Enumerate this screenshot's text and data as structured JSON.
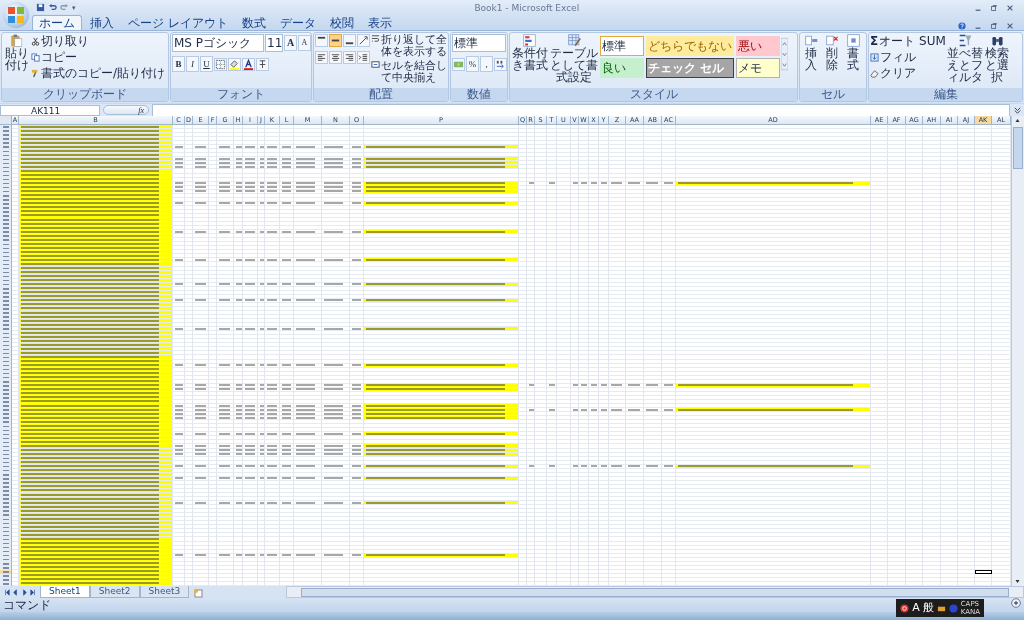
{
  "window": {
    "title": "Book1 - Microsoft Excel"
  },
  "quick_access": {
    "customize": "▾"
  },
  "tabs": [
    {
      "label": "ホーム",
      "selected": true
    },
    {
      "label": "挿入",
      "selected": false
    },
    {
      "label": "ページ レイアウト",
      "selected": false
    },
    {
      "label": "数式",
      "selected": false
    },
    {
      "label": "データ",
      "selected": false
    },
    {
      "label": "校閲",
      "selected": false
    },
    {
      "label": "表示",
      "selected": false
    }
  ],
  "ribbon": {
    "clipboard": {
      "label": "クリップボード",
      "paste": "貼り付け",
      "cut": "切り取り",
      "copy": "コピー",
      "format_painter": "書式のコピー/貼り付け"
    },
    "font": {
      "label": "フォント",
      "font_name": "MS Pゴシック",
      "font_size": "11",
      "grow": "A",
      "shrink": "A",
      "bold": "B",
      "italic": "I",
      "underline": "U"
    },
    "alignment": {
      "label": "配置",
      "vertical": [
        {
          "selected": false
        },
        {
          "selected": true
        },
        {
          "selected": false
        }
      ],
      "wrap": "折り返して全体を表示する",
      "merge": "セルを結合して中央揃え"
    },
    "number": {
      "label": "数値",
      "format": "標準",
      "percent": "%",
      "comma": ","
    },
    "styles": {
      "label": "スタイル",
      "conditional": "条件付き書式",
      "table": "テーブルとして書式設定",
      "gallery": [
        {
          "label": "標準",
          "kind": "normal",
          "selected": true
        },
        {
          "label": "どちらでもない",
          "kind": "neutral",
          "selected": false
        },
        {
          "label": "悪い",
          "kind": "bad",
          "selected": false
        },
        {
          "label": "良い",
          "kind": "good",
          "selected": false
        },
        {
          "label": "チェック セル",
          "kind": "check",
          "selected": false
        },
        {
          "label": "メモ",
          "kind": "note",
          "selected": false
        }
      ]
    },
    "cells": {
      "label": "セル",
      "insert": "挿入",
      "delete": "削除",
      "format": "書式"
    },
    "editing": {
      "label": "編集",
      "sigma": "Σ",
      "autosum": "オート SUM",
      "fill": "フィル",
      "clear": "クリア",
      "sort": "並べ替えとフィルタ",
      "find": "検索と選択"
    }
  },
  "formula_bar": {
    "name_box": "AK111",
    "fx": "fx"
  },
  "sheet": {
    "columns": [
      {
        "label": "A",
        "selected": false
      },
      {
        "label": "B",
        "selected": false
      },
      {
        "label": "C",
        "selected": false
      },
      {
        "label": "D",
        "selected": false
      },
      {
        "label": "E",
        "selected": false
      },
      {
        "label": "F",
        "selected": false
      },
      {
        "label": "G",
        "selected": false
      },
      {
        "label": "H",
        "selected": false
      },
      {
        "label": "I",
        "selected": false
      },
      {
        "label": "J",
        "selected": false
      },
      {
        "label": "K",
        "selected": false
      },
      {
        "label": "L",
        "selected": false
      },
      {
        "label": "M",
        "selected": false
      },
      {
        "label": "N",
        "selected": false
      },
      {
        "label": "O",
        "selected": false
      },
      {
        "label": "P",
        "selected": false
      },
      {
        "label": "Q",
        "selected": false
      },
      {
        "label": "R",
        "selected": false
      },
      {
        "label": "S",
        "selected": false
      },
      {
        "label": "T",
        "selected": false
      },
      {
        "label": "U",
        "selected": false
      },
      {
        "label": "V",
        "selected": false
      },
      {
        "label": "W",
        "selected": false
      },
      {
        "label": "X",
        "selected": false
      },
      {
        "label": "Y",
        "selected": false
      },
      {
        "label": "Z",
        "selected": false
      },
      {
        "label": "AA",
        "selected": false
      },
      {
        "label": "AB",
        "selected": false
      },
      {
        "label": "AC",
        "selected": false
      },
      {
        "label": "AD",
        "selected": false
      },
      {
        "label": "AE",
        "selected": false
      },
      {
        "label": "AF",
        "selected": false
      },
      {
        "label": "AG",
        "selected": false
      },
      {
        "label": "AH",
        "selected": false
      },
      {
        "label": "AI",
        "selected": false
      },
      {
        "label": "AJ",
        "selected": false
      },
      {
        "label": "AK",
        "selected": true
      },
      {
        "label": "AL",
        "selected": false
      }
    ],
    "rows": [
      {
        "kind": "url",
        "selected": false
      },
      {
        "kind": "url",
        "selected": false
      },
      {
        "kind": "url",
        "selected": false
      },
      {
        "kind": "url",
        "selected": false
      },
      {
        "kind": "url",
        "selected": false
      },
      {
        "kind": "tag",
        "extended": false,
        "selected": false
      },
      {
        "kind": "url",
        "selected": false
      },
      {
        "kind": "url",
        "selected": false
      },
      {
        "kind": "tag",
        "extended": false,
        "selected": false
      },
      {
        "kind": "tag",
        "extended": false,
        "selected": false
      },
      {
        "kind": "tag",
        "extended": false,
        "selected": false
      },
      {
        "kind": "url",
        "selected": false
      },
      {
        "kind": "url",
        "selected": false
      },
      {
        "kind": "url",
        "selected": false
      },
      {
        "kind": "tag",
        "extended": true,
        "selected": false
      },
      {
        "kind": "tag",
        "extended": false,
        "selected": false
      },
      {
        "kind": "tag",
        "extended": false,
        "selected": false
      },
      {
        "kind": "url",
        "selected": false
      },
      {
        "kind": "url",
        "selected": false
      },
      {
        "kind": "tag",
        "extended": false,
        "selected": false
      },
      {
        "kind": "url",
        "selected": false
      },
      {
        "kind": "url",
        "selected": false
      },
      {
        "kind": "url",
        "selected": false
      },
      {
        "kind": "url",
        "selected": false
      },
      {
        "kind": "url",
        "selected": false
      },
      {
        "kind": "url",
        "selected": false
      },
      {
        "kind": "tag",
        "extended": false,
        "selected": false
      },
      {
        "kind": "url",
        "selected": false
      },
      {
        "kind": "url",
        "selected": false
      },
      {
        "kind": "url",
        "selected": false
      },
      {
        "kind": "url",
        "selected": false
      },
      {
        "kind": "url",
        "selected": false
      },
      {
        "kind": "url",
        "selected": false
      },
      {
        "kind": "tag",
        "extended": false,
        "selected": false
      },
      {
        "kind": "url",
        "selected": false
      },
      {
        "kind": "url",
        "selected": false
      },
      {
        "kind": "url",
        "selected": false
      },
      {
        "kind": "url",
        "selected": false
      },
      {
        "kind": "url",
        "selected": false
      },
      {
        "kind": "tag",
        "extended": false,
        "selected": false
      },
      {
        "kind": "url",
        "selected": false
      },
      {
        "kind": "url",
        "selected": false
      },
      {
        "kind": "url",
        "selected": false
      },
      {
        "kind": "tag",
        "extended": false,
        "selected": false
      },
      {
        "kind": "url",
        "selected": false
      },
      {
        "kind": "url",
        "selected": false
      },
      {
        "kind": "url",
        "selected": false
      },
      {
        "kind": "url",
        "selected": false
      },
      {
        "kind": "url",
        "selected": false
      },
      {
        "kind": "url",
        "selected": false
      },
      {
        "kind": "tag",
        "extended": false,
        "selected": false
      },
      {
        "kind": "url",
        "selected": false
      },
      {
        "kind": "url",
        "selected": false
      },
      {
        "kind": "url",
        "selected": false
      },
      {
        "kind": "url",
        "selected": false
      },
      {
        "kind": "url",
        "selected": false
      },
      {
        "kind": "url",
        "selected": false
      },
      {
        "kind": "url",
        "selected": false
      },
      {
        "kind": "url",
        "selected": false
      },
      {
        "kind": "tag",
        "extended": false,
        "selected": false
      },
      {
        "kind": "url",
        "selected": false
      },
      {
        "kind": "url",
        "selected": false
      },
      {
        "kind": "url",
        "selected": false
      },
      {
        "kind": "url",
        "selected": false
      },
      {
        "kind": "tag",
        "extended": true,
        "selected": false
      },
      {
        "kind": "tag",
        "extended": false,
        "selected": false
      },
      {
        "kind": "url",
        "selected": false
      },
      {
        "kind": "url",
        "selected": false
      },
      {
        "kind": "url",
        "selected": false
      },
      {
        "kind": "tag",
        "extended": false,
        "selected": false
      },
      {
        "kind": "tag",
        "extended": true,
        "selected": false
      },
      {
        "kind": "tag",
        "extended": false,
        "selected": false
      },
      {
        "kind": "tag",
        "extended": false,
        "selected": false
      },
      {
        "kind": "url",
        "selected": false
      },
      {
        "kind": "url",
        "selected": false
      },
      {
        "kind": "url",
        "selected": false
      },
      {
        "kind": "tag",
        "extended": false,
        "selected": false
      },
      {
        "kind": "url",
        "selected": false
      },
      {
        "kind": "url",
        "selected": false
      },
      {
        "kind": "tag",
        "extended": false,
        "selected": false
      },
      {
        "kind": "tag",
        "extended": false,
        "selected": false
      },
      {
        "kind": "tag",
        "extended": false,
        "selected": false
      },
      {
        "kind": "url",
        "selected": false
      },
      {
        "kind": "url",
        "selected": false
      },
      {
        "kind": "tag",
        "extended": true,
        "selected": false
      },
      {
        "kind": "url",
        "selected": false
      },
      {
        "kind": "url",
        "selected": false
      },
      {
        "kind": "tag",
        "extended": false,
        "selected": false
      },
      {
        "kind": "url",
        "selected": false
      },
      {
        "kind": "url",
        "selected": false
      },
      {
        "kind": "url",
        "selected": false
      },
      {
        "kind": "url",
        "selected": false
      },
      {
        "kind": "url",
        "selected": false
      },
      {
        "kind": "tag",
        "extended": false,
        "selected": false
      },
      {
        "kind": "url",
        "selected": false
      },
      {
        "kind": "url",
        "selected": false
      },
      {
        "kind": "url",
        "selected": false
      },
      {
        "kind": "url",
        "selected": false
      },
      {
        "kind": "url",
        "selected": false
      },
      {
        "kind": "url",
        "selected": false
      },
      {
        "kind": "url",
        "selected": false
      },
      {
        "kind": "url",
        "selected": false
      },
      {
        "kind": "url",
        "selected": false
      },
      {
        "kind": "url",
        "selected": false
      },
      {
        "kind": "url",
        "selected": false
      },
      {
        "kind": "url",
        "selected": false
      },
      {
        "kind": "tag",
        "extended": false,
        "selected": false
      },
      {
        "kind": "url",
        "selected": false
      },
      {
        "kind": "url",
        "selected": false
      },
      {
        "kind": "url",
        "selected": false
      },
      {
        "kind": "url",
        "selected": true
      },
      {
        "kind": "url",
        "selected": false
      },
      {
        "kind": "url",
        "selected": false
      },
      {
        "kind": "url",
        "selected": false
      }
    ]
  },
  "sheet_tabs": [
    {
      "label": "Sheet1",
      "selected": true
    },
    {
      "label": "Sheet2",
      "selected": false
    },
    {
      "label": "Sheet3",
      "selected": false
    }
  ],
  "status_bar": {
    "mode": "コマンド"
  },
  "ime": {
    "input_mode": "A",
    "dictionary": "般",
    "caps": "CAPS",
    "kana": "KANA"
  }
}
